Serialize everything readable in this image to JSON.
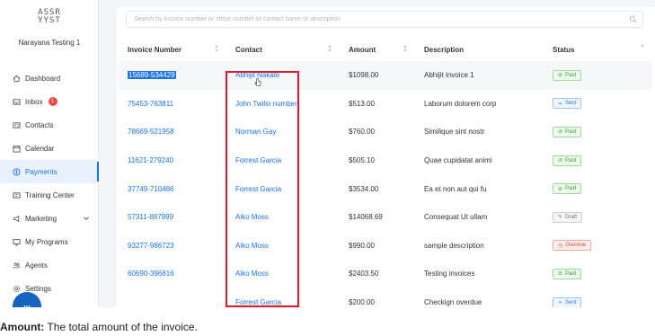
{
  "sidebar": {
    "logo_line1": "ASSR",
    "logo_line2": "YYST",
    "account_name": "Narayana Testing 1",
    "items": [
      {
        "label": "Dashboard",
        "icon": "home-icon"
      },
      {
        "label": "Inbox",
        "icon": "inbox-icon",
        "badge": "1"
      },
      {
        "label": "Contacts",
        "icon": "contacts-icon"
      },
      {
        "label": "Calendar",
        "icon": "calendar-icon"
      },
      {
        "label": "Payments",
        "icon": "payments-icon",
        "active": true
      },
      {
        "label": "Training Center",
        "icon": "training-icon"
      },
      {
        "label": "Marketing",
        "icon": "marketing-icon",
        "expandable": true
      },
      {
        "label": "My Programs",
        "icon": "programs-icon"
      },
      {
        "label": "Agents",
        "icon": "agents-icon"
      },
      {
        "label": "Settings",
        "icon": "settings-icon"
      }
    ]
  },
  "search": {
    "placeholder": "Search by invoice number or stripe number or contact name or description"
  },
  "table": {
    "headers": {
      "invoice": "Invoice Number",
      "contact": "Contact",
      "amount": "Amount",
      "description": "Description",
      "status": "Status"
    },
    "rows": [
      {
        "invoice": "15689-534429",
        "contact": "Abhijit Nakate",
        "amount": "$1098.00",
        "description": "Abhijit invoice 1",
        "status": "Paid"
      },
      {
        "invoice": "75453-763811",
        "contact": "John Twilio number",
        "amount": "$513.00",
        "description": "Laborum dolorem corp",
        "status": "Sent"
      },
      {
        "invoice": "78669-521958",
        "contact": "Norman Gay",
        "amount": "$760.00",
        "description": "Similique sint nostr",
        "status": "Paid"
      },
      {
        "invoice": "11621-279240",
        "contact": "Forrest Garcia",
        "amount": "$505.10",
        "description": "Quae cupidatat animi",
        "status": "Paid"
      },
      {
        "invoice": "37749-710486",
        "contact": "Forrest Garcia",
        "amount": "$3534.00",
        "description": "Ea et non aut qui fu",
        "status": "Paid"
      },
      {
        "invoice": "57311-887999",
        "contact": "Aiko Moss",
        "amount": "$14068.69",
        "description": "Consequat Ut ullam",
        "status": "Draft"
      },
      {
        "invoice": "93277-986723",
        "contact": "Aiko Moss",
        "amount": "$990.00",
        "description": "sample description",
        "status": "Overdue"
      },
      {
        "invoice": "60690-396816",
        "contact": "Aiko Moss",
        "amount": "$2403.50",
        "description": "Testing invoices",
        "status": "Paid"
      },
      {
        "invoice": "",
        "contact": "Forrest Garcia",
        "amount": "$200.00",
        "description": "Checkign overdue",
        "status": "Sent"
      }
    ]
  },
  "caption": {
    "bold": "Amount:",
    "text": " The total amount of the invoice."
  },
  "colors": {
    "accent": "#1a73e8",
    "highlight_box": "#e0162b"
  }
}
